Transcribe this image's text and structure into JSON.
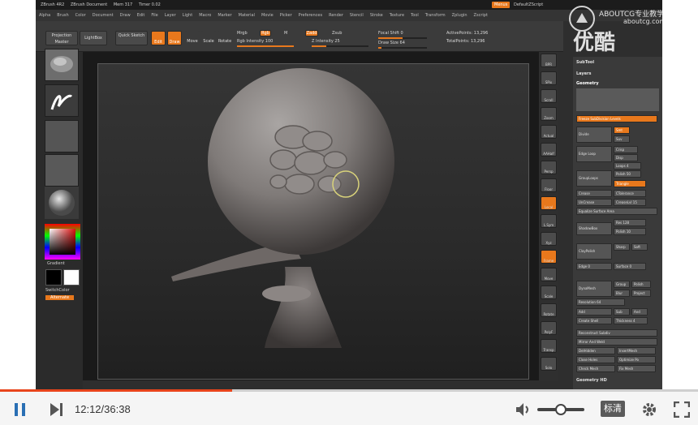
{
  "app": {
    "title_items": [
      "ZBrush 4R2",
      "ZBrush Document",
      "Mem 317",
      "Timer 0.02"
    ],
    "menu_right": [
      "Menus",
      "DefaultZScript"
    ],
    "menus": [
      "Alpha",
      "Brush",
      "Color",
      "Document",
      "Draw",
      "Edit",
      "File",
      "Layer",
      "Light",
      "Macro",
      "Marker",
      "Material",
      "Movie",
      "Picker",
      "Preferences",
      "Render",
      "Stencil",
      "Stroke",
      "Texture",
      "Tool",
      "Transform",
      "Zplugin",
      "Zscript"
    ]
  },
  "toolbar": {
    "projection_master": "Projection Master",
    "lightbox": "LightBox",
    "quick_sketch": "Quick Sketch",
    "edit": "Edit",
    "draw": "Draw",
    "move": "Move",
    "scale": "Scale",
    "rotate": "Rotate",
    "mrgb": "Mrgb",
    "rgb": "Rgb",
    "m": "M",
    "rgb_intensity_label": "Rgb Intensity",
    "rgb_intensity_value": "100",
    "rgb_intensity_fraction": 1.0,
    "zadd": "Zadd",
    "zsub": "Zsub",
    "z_intensity_label": "Z Intensity",
    "z_intensity_value": "25",
    "z_intensity_fraction": 0.25,
    "focal_shift_label": "Focal Shift",
    "focal_shift_value": "0",
    "focal_shift_fraction": 0.5,
    "draw_size_label": "Draw Size",
    "draw_size_value": "64",
    "draw_size_fraction": 0.06,
    "active_points": "ActivePoints: 13,296",
    "total_points": "TotalPoints: 13,296"
  },
  "left_shelf": {
    "gradient": "Gradient",
    "switch_color": "SwitchColor",
    "alternate": "Alternate"
  },
  "right_shelf": {
    "items": [
      "BPR",
      "SPix",
      "Scroll",
      "Zoom",
      "Actual",
      "AAHalf",
      "Persp",
      "Floor",
      "Local",
      "L.Sym",
      "Xyz",
      "Frame",
      "Move",
      "Scale",
      "Rotate",
      "PolyF",
      "Transp",
      "Solo"
    ]
  },
  "palette": {
    "subtool": "SubTool",
    "layers": "Layers",
    "geometry": "Geometry",
    "freeze_subdivision_levels": "Freeze SubDivision Levels",
    "divide": "Divide",
    "smt": "Smt",
    "suv": "Suv",
    "edge_loop": "Edge Loop",
    "crisp": "Crisp",
    "disp": "Disp",
    "loops": "Loops 4",
    "grouploops": "GroupLoops",
    "polish": "Polish 50",
    "triangle": "Triangle",
    "crease": "Crease",
    "ctolerance": "CTolerance",
    "uncrease": "UnCrease",
    "creaselvl": "CreaseLvl 15",
    "equalize": "Equalize Surface Area",
    "res": "Res 128",
    "shadowbox": "ShadowBox",
    "polish10": "Polish 10",
    "claypolish": "ClayPolish",
    "sharp": "Sharp",
    "soft": "Soft",
    "edge": "Edge 0",
    "surface": "Surface 0",
    "dynamesh": "DynaMesh",
    "group": "Group",
    "polish_btn": "Polish",
    "blur": "Blur",
    "project": "Project",
    "resolution": "Resolution 64",
    "add": "Add",
    "sub": "Sub",
    "and": "And",
    "create_shell": "Create Shell",
    "thickness": "Thickness 4",
    "reconstruct": "Reconstruct Subdiv",
    "mirror_weld": "Mirror And Weld",
    "delhidden": "DelHidden",
    "insertmesh": "InsertMesh",
    "close_holes": "Close Holes",
    "optimize": "Optimize Po",
    "check_mesh": "Check Mesh",
    "fix_mesh": "Fix Mesh",
    "geometry_hd": "Geometry HD"
  },
  "watermark": {
    "brand": "优酷",
    "sub": "ABOUTCG专业教学",
    "site": "aboutcg.com"
  },
  "player": {
    "current_time": "12:12",
    "total_time": "36:38",
    "time_display": "12:12/36:38",
    "progress_fraction": 0.333,
    "volume_fraction": 0.5,
    "quality": "标清"
  },
  "colors": {
    "accent": "#e8781c",
    "progress": "#e8451c",
    "player_icon": "#2a6fb4"
  }
}
